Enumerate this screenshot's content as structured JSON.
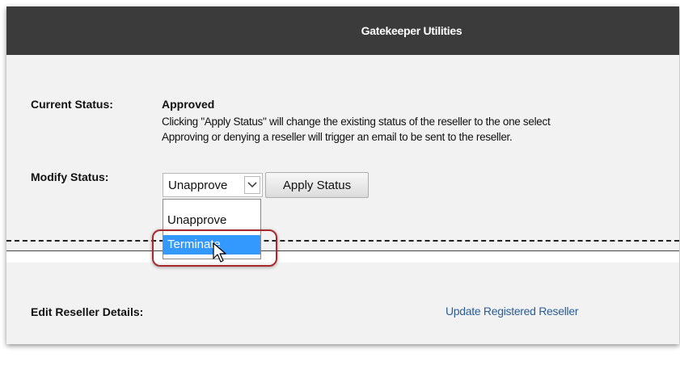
{
  "header": {
    "title": "Gatekeeper Utilities"
  },
  "status": {
    "current_label": "Current Status:",
    "current_value": "Approved",
    "note_line1": "Clicking \"Apply Status\" will change the existing status of the reseller to the one select",
    "note_line2": "Approving or denying a reseller will trigger an email to be sent to the reseller."
  },
  "modify": {
    "label": "Modify Status:",
    "selected_value": "Unapprove",
    "apply_button": "Apply Status",
    "options": [
      "Unapprove",
      "Terminate"
    ],
    "highlighted_option": "Terminate"
  },
  "details": {
    "label": "Edit Reseller Details:",
    "link": "Update Registered Reseller"
  },
  "colors": {
    "header_bg": "#3b3b3b",
    "highlight_option": "#3399ff",
    "callout_border": "#a8282c",
    "link": "#2a5d97"
  },
  "icons": [
    "chevron-down-icon",
    "mouse-cursor-icon"
  ]
}
